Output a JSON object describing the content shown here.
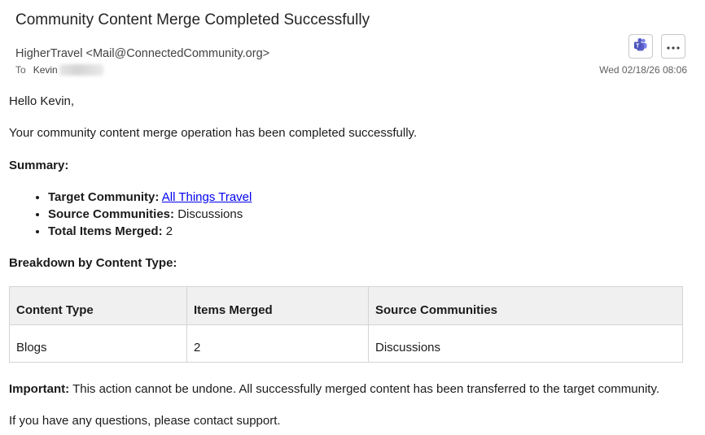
{
  "email": {
    "subject": "Community Content Merge Completed Successfully",
    "sender": "HigherTravel <Mail@ConnectedCommunity.org>",
    "to_label": "To",
    "to_name": "Kevin",
    "date": "Wed 02/18/26 08:06"
  },
  "toolbar": {
    "teams_icon": "teams-icon",
    "more_icon": "more-options-icon"
  },
  "body": {
    "greeting": "Hello Kevin,",
    "intro": "Your community content merge operation has been completed successfully.",
    "summary_heading": "Summary:",
    "summary_items": [
      {
        "label": "Target Community:",
        "value": "All Things Travel",
        "is_link": true
      },
      {
        "label": "Source Communities:",
        "value": "Discussions"
      },
      {
        "label": "Total Items Merged:",
        "value": "2"
      }
    ],
    "breakdown_heading": "Breakdown by Content Type:",
    "table": {
      "headers": [
        "Content Type",
        "Items Merged",
        "Source Communities"
      ],
      "rows": [
        [
          "Blogs",
          "2",
          "Discussions"
        ]
      ]
    },
    "important_label": "Important:",
    "important_text": " This action cannot be undone. All successfully merged content has been transferred to the target community.",
    "closing": "If you have any questions, please contact support."
  },
  "colors": {
    "link": "#0000ee",
    "teams": "#5b5fc7",
    "table_header_bg": "#f0f0f0"
  }
}
